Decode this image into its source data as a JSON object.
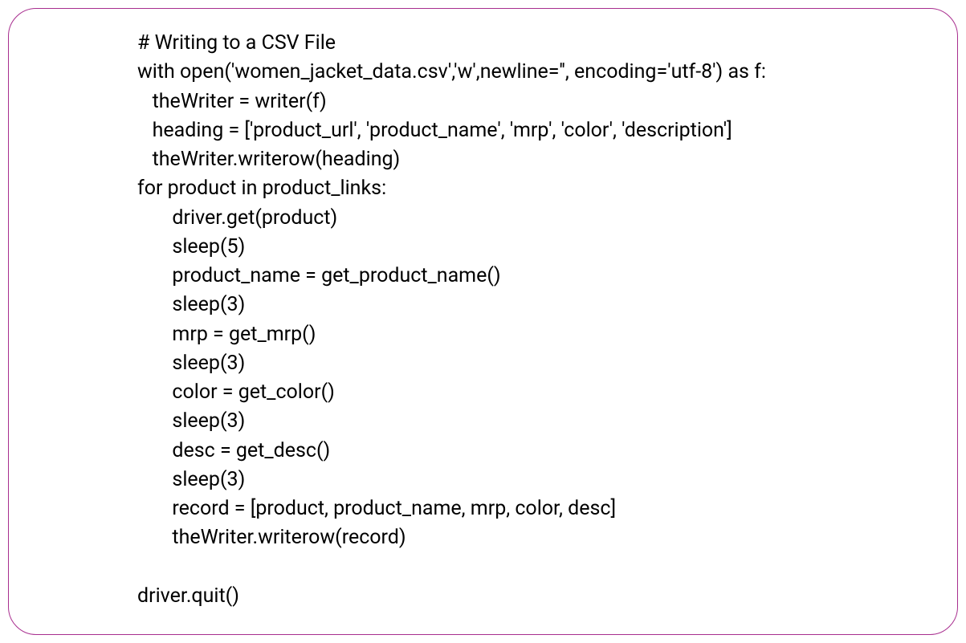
{
  "code": {
    "lines": [
      "# Writing to a CSV File",
      "with open('women_jacket_data.csv','w',newline='', encoding='utf-8') as f:",
      "   theWriter = writer(f)",
      "   heading = ['product_url', 'product_name', 'mrp', 'color', 'description']",
      "   theWriter.writerow(heading)",
      "for product in product_links:",
      "       driver.get(product)",
      "       sleep(5)",
      "       product_name = get_product_name()",
      "       sleep(3)",
      "       mrp = get_mrp()",
      "       sleep(3)",
      "       color = get_color()",
      "       sleep(3)",
      "       desc = get_desc()",
      "       sleep(3)",
      "       record = [product, product_name, mrp, color, desc]",
      "       theWriter.writerow(record)",
      "",
      "driver.quit()"
    ]
  }
}
